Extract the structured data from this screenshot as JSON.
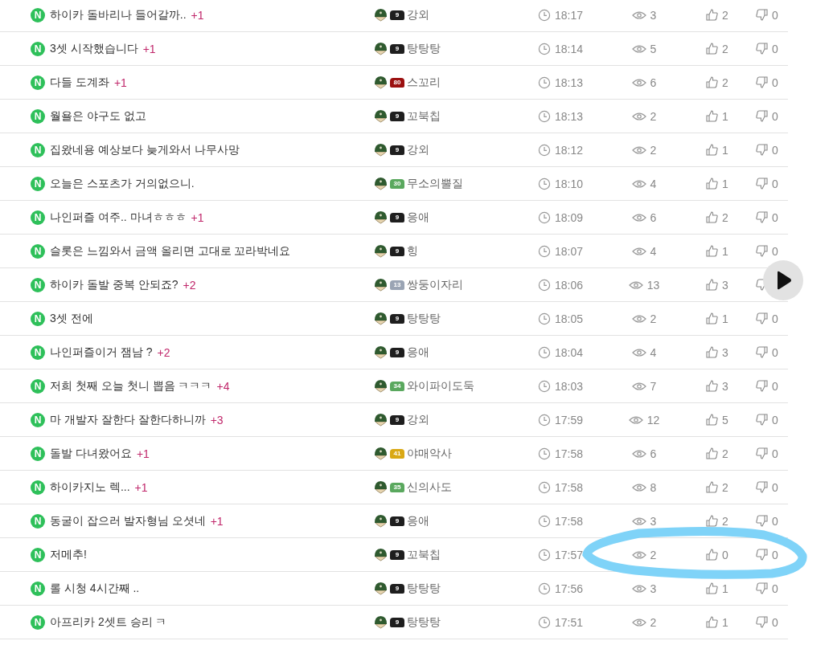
{
  "posts": [
    {
      "new_badge": "N",
      "title": "하이카 돌바리나 들어갈까..",
      "replies": "+1",
      "author": "강외",
      "badge": {
        "label": "9",
        "color": "#1e1e1e"
      },
      "time": "18:17",
      "views": "3",
      "likes": "2",
      "dislikes": "0"
    },
    {
      "new_badge": "N",
      "title": "3셋 시작했습니다",
      "replies": "+1",
      "author": "탕탕탕",
      "badge": {
        "label": "9",
        "color": "#1e1e1e"
      },
      "time": "18:14",
      "views": "5",
      "likes": "2",
      "dislikes": "0"
    },
    {
      "new_badge": "N",
      "title": "다들 도계좌",
      "replies": "+1",
      "author": "스꼬리",
      "badge": {
        "label": "80",
        "color": "#9b1010"
      },
      "time": "18:13",
      "views": "6",
      "likes": "2",
      "dislikes": "0"
    },
    {
      "new_badge": "N",
      "title": "월욜은 야구도 없고",
      "author": "꼬북칩",
      "badge": {
        "label": "9",
        "color": "#1e1e1e"
      },
      "time": "18:13",
      "views": "2",
      "likes": "1",
      "dislikes": "0"
    },
    {
      "new_badge": "N",
      "title": "집왔네용 예상보다 늦게와서 나무사망",
      "author": "강외",
      "badge": {
        "label": "9",
        "color": "#1e1e1e"
      },
      "time": "18:12",
      "views": "2",
      "likes": "1",
      "dislikes": "0"
    },
    {
      "new_badge": "N",
      "title": "오늘은 스포츠가 거의없으니.",
      "author": "무소의뿔질",
      "badge": {
        "label": "30",
        "color": "#5aa85e"
      },
      "time": "18:10",
      "views": "4",
      "likes": "1",
      "dislikes": "0"
    },
    {
      "new_badge": "N",
      "title": "나인퍼즐 여주.. 마녀ㅎㅎㅎ",
      "replies": "+1",
      "author": "응애",
      "badge": {
        "label": "9",
        "color": "#1e1e1e"
      },
      "time": "18:09",
      "views": "6",
      "likes": "2",
      "dislikes": "0"
    },
    {
      "new_badge": "N",
      "title": "슬롯은 느낌와서 금액 올리면 고대로 꼬라박네요",
      "author": "힝",
      "badge": {
        "label": "9",
        "color": "#1e1e1e"
      },
      "time": "18:07",
      "views": "4",
      "likes": "1",
      "dislikes": "0"
    },
    {
      "new_badge": "N",
      "title": "하이카 돌발 중복 안되죠?",
      "replies": "+2",
      "author": "쌍둥이자리",
      "badge": {
        "label": "13",
        "color": "#9aa4b4"
      },
      "time": "18:06",
      "views": "13",
      "likes": "3"
    },
    {
      "new_badge": "N",
      "title": "3셋 전에",
      "author": "탕탕탕",
      "badge": {
        "label": "9",
        "color": "#1e1e1e"
      },
      "time": "18:05",
      "views": "2",
      "likes": "1",
      "dislikes": "0"
    },
    {
      "new_badge": "N",
      "title": "나인퍼즐이거 잼남 ?",
      "replies": "+2",
      "author": "응애",
      "badge": {
        "label": "9",
        "color": "#1e1e1e"
      },
      "time": "18:04",
      "views": "4",
      "likes": "3",
      "dislikes": "0"
    },
    {
      "new_badge": "N",
      "title": "저희 첫째 오늘 첫니 뽑음 ㅋㅋㅋ",
      "replies": "+4",
      "author": "와이파이도둑",
      "badge": {
        "label": "34",
        "color": "#5aa85e"
      },
      "time": "18:03",
      "views": "7",
      "likes": "3",
      "dislikes": "0"
    },
    {
      "new_badge": "N",
      "title": "마 개발자 잘한다 잘한다하니까",
      "replies": "+3",
      "author": "강외",
      "badge": {
        "label": "9",
        "color": "#1e1e1e"
      },
      "time": "17:59",
      "views": "12",
      "likes": "5",
      "dislikes": "0"
    },
    {
      "new_badge": "N",
      "title": "돌발 다녀왔어요",
      "replies": "+1",
      "author": "야매악사",
      "badge": {
        "label": "41",
        "color": "#d9a814"
      },
      "time": "17:58",
      "views": "6",
      "likes": "2",
      "dislikes": "0"
    },
    {
      "new_badge": "N",
      "title": "하이카지노 렉...",
      "replies": "+1",
      "author": "신의사도",
      "badge": {
        "label": "35",
        "color": "#5aa85e"
      },
      "time": "17:58",
      "views": "8",
      "likes": "2",
      "dislikes": "0"
    },
    {
      "new_badge": "N",
      "title": "동굴이 잡으러 발자형님 오셧네",
      "replies": "+1",
      "author": "응애",
      "badge": {
        "label": "9",
        "color": "#1e1e1e"
      },
      "time": "17:58",
      "views": "3",
      "likes": "2",
      "dislikes": "0"
    },
    {
      "new_badge": "N",
      "title": "저메추!",
      "author": "꼬북칩",
      "badge": {
        "label": "9",
        "color": "#1e1e1e"
      },
      "time": "17:57",
      "views": "2",
      "likes": "0",
      "dislikes": "0"
    },
    {
      "new_badge": "N",
      "title": "롤 시청 4시간째 ..",
      "author": "탕탕탕",
      "badge": {
        "label": "9",
        "color": "#1e1e1e"
      },
      "time": "17:56",
      "views": "3",
      "likes": "1",
      "dislikes": "0"
    },
    {
      "new_badge": "N",
      "title": "아프리카 2셋트 승리 ㅋ",
      "author": "탕탕탕",
      "badge": {
        "label": "9",
        "color": "#1e1e1e"
      },
      "time": "17:51",
      "views": "2",
      "likes": "1",
      "dislikes": "0"
    }
  ]
}
